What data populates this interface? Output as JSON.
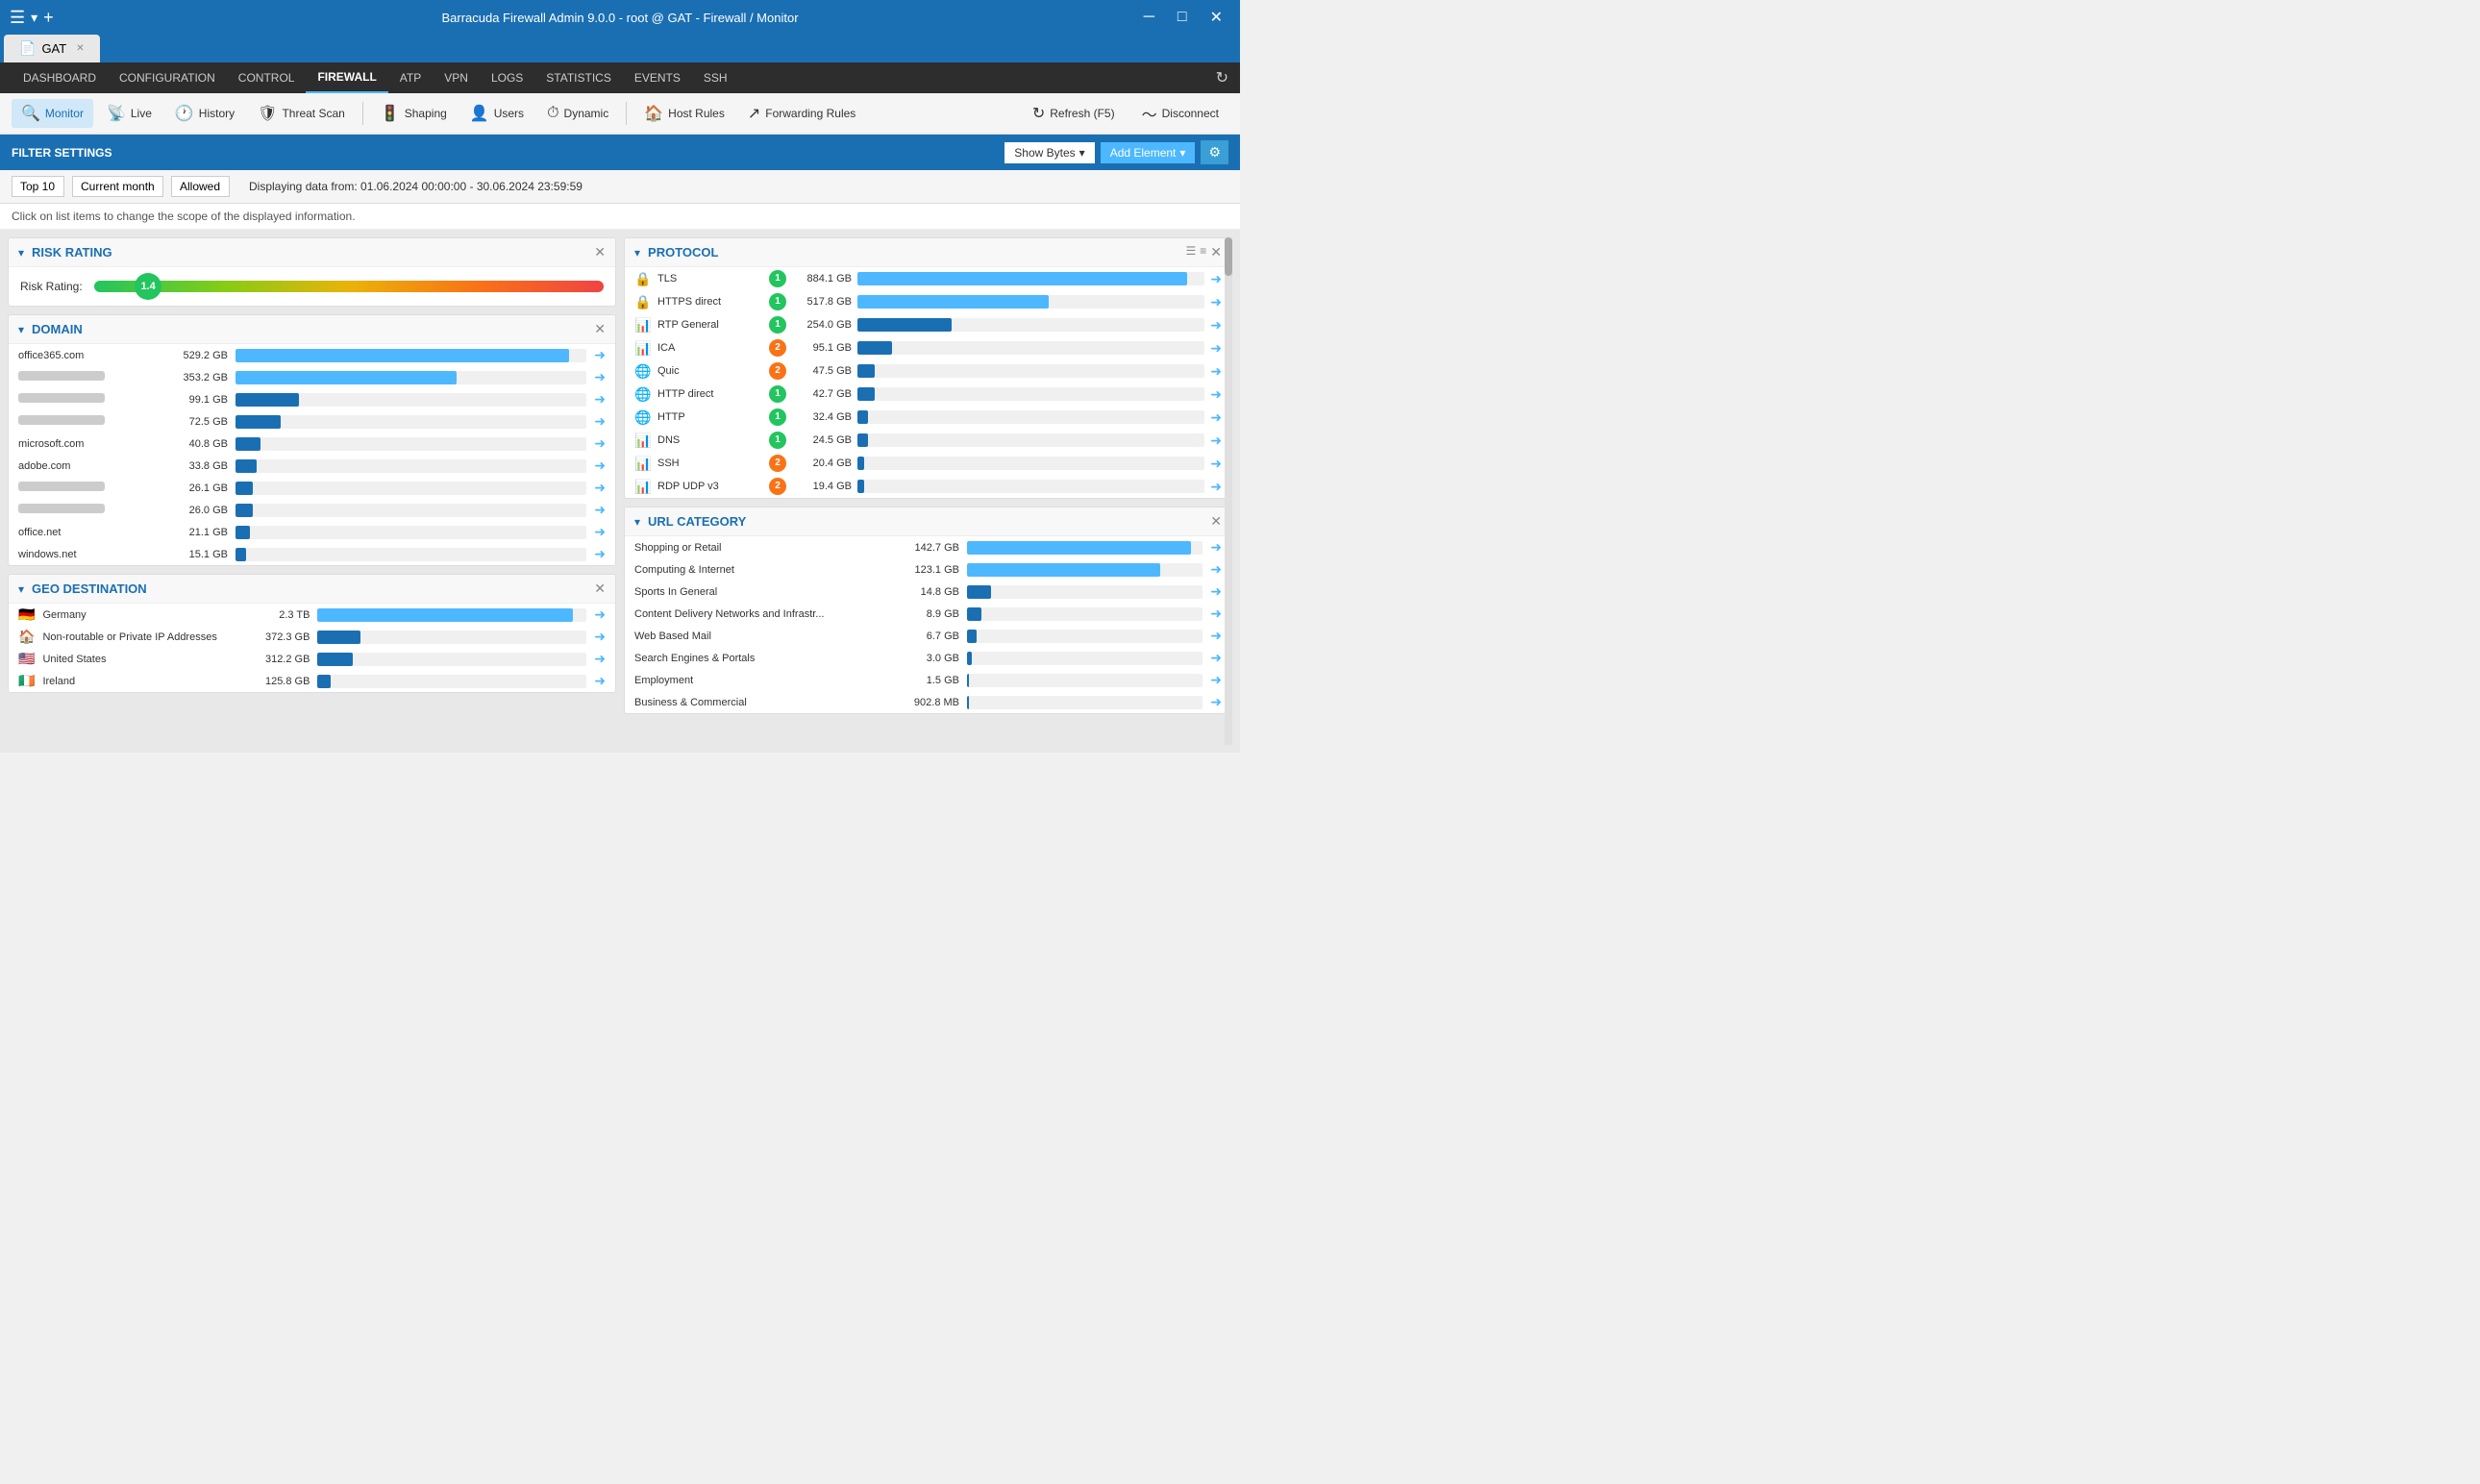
{
  "titleBar": {
    "title": "Barracuda Firewall Admin 9.0.0 -  root @ GAT   -  Firewall / Monitor"
  },
  "tabBar": {
    "tabLabel": "GAT"
  },
  "navBar": {
    "items": [
      "DASHBOARD",
      "CONFIGURATION",
      "CONTROL",
      "FIREWALL",
      "ATP",
      "VPN",
      "LOGS",
      "STATISTICS",
      "EVENTS",
      "SSH"
    ],
    "active": "FIREWALL"
  },
  "toolbar": {
    "monitor": "Monitor",
    "live": "Live",
    "history": "History",
    "threatScan": "Threat Scan",
    "shaping": "Shaping",
    "users": "Users",
    "dynamic": "Dynamic",
    "hostRules": "Host Rules",
    "forwardingRules": "Forwarding Rules",
    "refresh": "Refresh (F5)",
    "disconnect": "Disconnect"
  },
  "filterBar": {
    "label": "FILTER SETTINGS",
    "showBytes": "Show Bytes",
    "addElement": "Add Element"
  },
  "filterRow": {
    "top": "Top 10",
    "period": "Current month",
    "status": "Allowed",
    "dateRange": "Displaying data from: 01.06.2024 00:00:00 - 30.06.2024 23:59:59"
  },
  "infoText": "Click on list items to change the scope of the displayed information.",
  "riskRating": {
    "title": "RISK RATING",
    "label": "Risk Rating:",
    "value": "1.4",
    "percent": 8
  },
  "domain": {
    "title": "DOMAIN",
    "items": [
      {
        "label": "office365.com",
        "value": "529.2 GB",
        "pct": 95,
        "dark": false,
        "blurred": false
      },
      {
        "label": "—",
        "value": "353.2 GB",
        "pct": 63,
        "dark": false,
        "blurred": true
      },
      {
        "label": "—",
        "value": "99.1 GB",
        "pct": 18,
        "dark": true,
        "blurred": true
      },
      {
        "label": "—",
        "value": "72.5 GB",
        "pct": 13,
        "dark": true,
        "blurred": true
      },
      {
        "label": "microsoft.com",
        "value": "40.8 GB",
        "pct": 7,
        "dark": true,
        "blurred": false
      },
      {
        "label": "adobe.com",
        "value": "33.8 GB",
        "pct": 6,
        "dark": true,
        "blurred": false
      },
      {
        "label": "—",
        "value": "26.1 GB",
        "pct": 5,
        "dark": true,
        "blurred": true
      },
      {
        "label": "—",
        "value": "26.0 GB",
        "pct": 5,
        "dark": true,
        "blurred": true
      },
      {
        "label": "office.net",
        "value": "21.1 GB",
        "pct": 4,
        "dark": true,
        "blurred": false
      },
      {
        "label": "windows.net",
        "value": "15.1 GB",
        "pct": 3,
        "dark": true,
        "blurred": false
      }
    ]
  },
  "geoDestination": {
    "title": "GEO DESTINATION",
    "items": [
      {
        "label": "Germany",
        "value": "2.3 TB",
        "pct": 95,
        "dark": false,
        "flag": "🇩🇪"
      },
      {
        "label": "Non-routable or Private IP Addresses",
        "value": "372.3 GB",
        "pct": 16,
        "dark": true,
        "flag": "🏠"
      },
      {
        "label": "United States",
        "value": "312.2 GB",
        "pct": 13,
        "dark": true,
        "flag": "🇺🇸"
      },
      {
        "label": "Ireland",
        "value": "125.8 GB",
        "pct": 5,
        "dark": true,
        "flag": "🇮🇪"
      }
    ]
  },
  "protocol": {
    "title": "PROTOCOL",
    "items": [
      {
        "name": "TLS",
        "badge": "1",
        "badgeColor": "green",
        "value": "884.1 GB",
        "pct": 95,
        "dark": false
      },
      {
        "name": "HTTPS direct",
        "badge": "1",
        "badgeColor": "green",
        "value": "517.8 GB",
        "pct": 55,
        "dark": false
      },
      {
        "name": "RTP General",
        "badge": "1",
        "badgeColor": "green",
        "value": "254.0 GB",
        "pct": 27,
        "dark": true
      },
      {
        "name": "ICA",
        "badge": "2",
        "badgeColor": "orange",
        "value": "95.1 GB",
        "pct": 10,
        "dark": true
      },
      {
        "name": "Quic",
        "badge": "2",
        "badgeColor": "orange",
        "value": "47.5 GB",
        "pct": 5,
        "dark": true
      },
      {
        "name": "HTTP direct",
        "badge": "1",
        "badgeColor": "green",
        "value": "42.7 GB",
        "pct": 5,
        "dark": true
      },
      {
        "name": "HTTP",
        "badge": "1",
        "badgeColor": "green",
        "value": "32.4 GB",
        "pct": 3,
        "dark": true
      },
      {
        "name": "DNS",
        "badge": "1",
        "badgeColor": "green",
        "value": "24.5 GB",
        "pct": 3,
        "dark": true
      },
      {
        "name": "SSH",
        "badge": "2",
        "badgeColor": "orange",
        "value": "20.4 GB",
        "pct": 2,
        "dark": true
      },
      {
        "name": "RDP UDP v3",
        "badge": "2",
        "badgeColor": "orange",
        "value": "19.4 GB",
        "pct": 2,
        "dark": true
      }
    ]
  },
  "urlCategory": {
    "title": "URL CATEGORY",
    "items": [
      {
        "label": "Shopping or Retail",
        "value": "142.7 GB",
        "pct": 95,
        "dark": false
      },
      {
        "label": "Computing & Internet",
        "value": "123.1 GB",
        "pct": 82,
        "dark": false
      },
      {
        "label": "Sports In General",
        "value": "14.8 GB",
        "pct": 10,
        "dark": true
      },
      {
        "label": "Content Delivery Networks and Infrastr...",
        "value": "8.9 GB",
        "pct": 6,
        "dark": true
      },
      {
        "label": "Web Based Mail",
        "value": "6.7 GB",
        "pct": 4,
        "dark": true
      },
      {
        "label": "Search Engines & Portals",
        "value": "3.0 GB",
        "pct": 2,
        "dark": true
      },
      {
        "label": "Employment",
        "value": "1.5 GB",
        "pct": 1,
        "dark": true
      },
      {
        "label": "Business & Commercial",
        "value": "902.8 MB",
        "pct": 1,
        "dark": true
      }
    ]
  }
}
